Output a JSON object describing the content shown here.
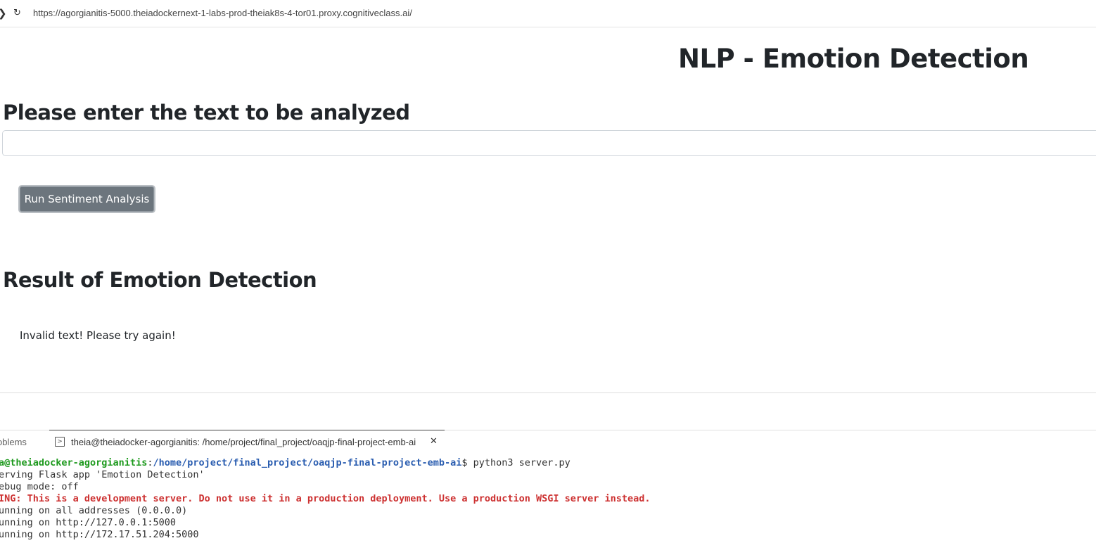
{
  "browser": {
    "url": "https://agorgianitis-5000.theiadockernext-1-labs-prod-theiak8s-4-tor01.proxy.cognitiveclass.ai/"
  },
  "app": {
    "title": "NLP - Emotion Detection",
    "prompt_heading": "Please enter the text to be analyzed",
    "text_input": {
      "value": "",
      "placeholder": ""
    },
    "run_button_label": "Run Sentiment Analysis",
    "result_heading": "Result of Emotion Detection",
    "result_text": "Invalid text! Please try again!"
  },
  "panel": {
    "tabs": [
      {
        "label": "oblems"
      },
      {
        "label": "theia@theiadocker-agorgianitis: /home/project/final_project/oaqjp-final-project-emb-ai"
      }
    ],
    "terminal": {
      "prompt_user": "a@theiadocker-agorgianitis",
      "prompt_sep": ":",
      "prompt_path": "/home/project/final_project/oaqjp-final-project-emb-ai",
      "prompt_cmd": "$ python3 server.py",
      "lines": [
        "erving Flask app 'Emotion Detection'",
        "ebug mode: off",
        "ING: This is a development server. Do not use it in a production deployment. Use a production WSGI server instead.",
        "unning on all addresses (0.0.0.0)",
        "unning on http://127.0.0.1:5000",
        "unning on http://172.17.51.204:5000"
      ]
    }
  },
  "colors": {
    "button_bg": "#6c757d",
    "prompt_user": "#1e9a1e",
    "prompt_path": "#2a5db0",
    "warning": "#cd3131"
  }
}
